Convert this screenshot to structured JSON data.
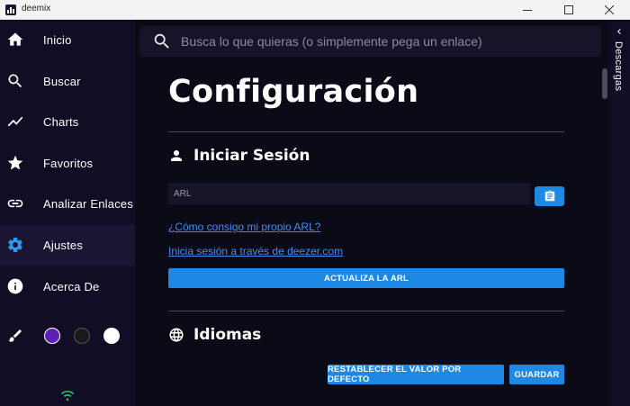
{
  "window": {
    "title": "deemix"
  },
  "sidebar": {
    "items": [
      {
        "label": "Inicio",
        "icon": "home-icon"
      },
      {
        "label": "Buscar",
        "icon": "search-icon"
      },
      {
        "label": "Charts",
        "icon": "trending-icon"
      },
      {
        "label": "Favoritos",
        "icon": "star-icon"
      },
      {
        "label": "Analizar Enlaces",
        "icon": "link-icon"
      },
      {
        "label": "Ajustes",
        "icon": "gear-icon",
        "active": true
      },
      {
        "label": "Acerca De",
        "icon": "info-icon"
      }
    ],
    "theme_swatches": [
      "#5b21b6",
      "#1a1a1a",
      "#ffffff"
    ],
    "connection_status_color": "#22c55e",
    "active_color": "#2b9bf0"
  },
  "search": {
    "placeholder": "Busca lo que quieras (o simplemente pega un enlace)"
  },
  "page": {
    "title": "Configuración",
    "login": {
      "title": "Iniciar Sesión",
      "arl_placeholder": "ARL",
      "link_arl": "¿Cómo consigo mi propio ARL?",
      "link_login": "Inicia sesión a través de deezer.com",
      "update_button": "ACTUALIZA LA ARL"
    },
    "languages": {
      "title": "Idiomas"
    },
    "reset_button": "RESTABLECER EL VALOR POR DEFECTO",
    "save_button": "GUARDAR"
  },
  "downloads_panel": {
    "label": "Descargas"
  },
  "colors": {
    "accent": "#1e88e5",
    "link": "#3b8ff5",
    "background": "#0b0a17",
    "sidebar": "#110d24"
  }
}
